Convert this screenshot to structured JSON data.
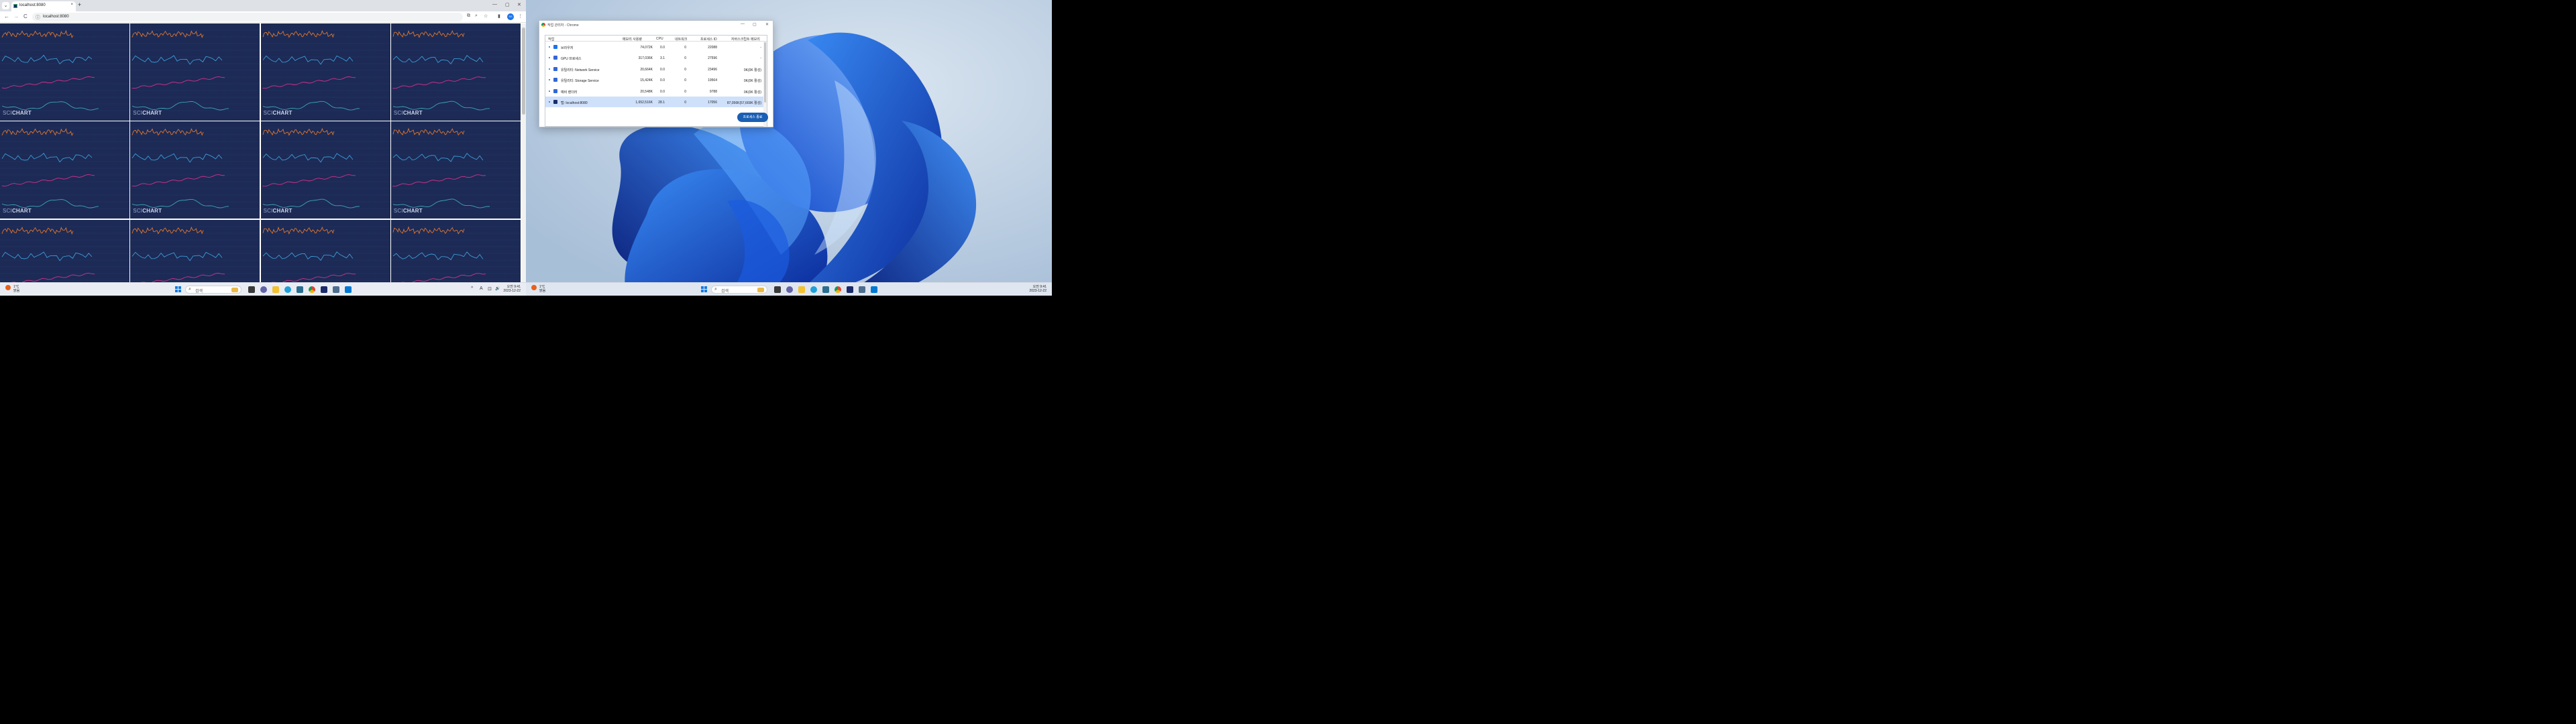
{
  "left_monitor": {
    "tab": {
      "title": "localhost:8080",
      "close": "×",
      "new_tab": "+",
      "menu": "⌄"
    },
    "window_controls": [
      "—",
      "▢",
      "✕"
    ],
    "toolbar": {
      "back": "←",
      "forward": "→",
      "reload": "C",
      "url": "localhost:8080",
      "site_icon": "ⓘ",
      "profile_initials": "SS"
    },
    "chart_grid": {
      "rows_visible": 3,
      "columns": 4,
      "logo_prefix": "SCI",
      "logo_suffix": "CHART",
      "series_colors": [
        "#e0762d",
        "#3d9bd6",
        "#d1328a",
        "#3fa5b8"
      ]
    }
  },
  "taskbar_left": {
    "weather_temp": "1°C",
    "weather_desc": "맑음",
    "search_placeholder": "검색",
    "clock_time": "오전 9:41",
    "clock_date": "2023-12-22",
    "tray": [
      "^",
      "A",
      "⊡",
      "🔊"
    ]
  },
  "task_manager": {
    "title": "작업 관리자 - Chrome",
    "window_controls": [
      "—",
      "▢",
      "✕"
    ],
    "columns": [
      "작업",
      "메모리 사용량",
      "CPU",
      "네트워크",
      "프로세스 ID",
      "자바스크립트 메모리"
    ],
    "rows": [
      {
        "name": "브라우저",
        "memory": "74,072K",
        "cpu": "0.0",
        "network": "0",
        "pid": "22088",
        "js_memory": "-",
        "icon_color": "#1a73e8",
        "selected": false
      },
      {
        "name": "GPU 프로세스",
        "memory": "317,036K",
        "cpu": "3.1",
        "network": "0",
        "pid": "27596",
        "js_memory": "-",
        "icon_color": "#3367d6",
        "selected": false
      },
      {
        "name": "유틸리티: Network Service",
        "memory": "20,664K",
        "cpu": "0.0",
        "network": "0",
        "pid": "23496",
        "js_memory": "0K(0K 활성)",
        "icon_color": "#3367d6",
        "selected": false
      },
      {
        "name": "유틸리티: Storage Service",
        "memory": "15,424K",
        "cpu": "0.0",
        "network": "0",
        "pid": "19564",
        "js_memory": "0K(0K 활성)",
        "icon_color": "#3367d6",
        "selected": false
      },
      {
        "name": "예비 렌더러",
        "memory": "20,548K",
        "cpu": "0.0",
        "network": "0",
        "pid": "9788",
        "js_memory": "0K(0K 활성)",
        "icon_color": "#3367d6",
        "selected": false
      },
      {
        "name": "탭: localhost:8080",
        "memory": "1,652,516K",
        "cpu": "28.1",
        "network": "0",
        "pid": "17056",
        "js_memory": "87,056K(57,669K 활성)",
        "icon_color": "#1a2a6c",
        "selected": true
      }
    ],
    "end_process_button": "프로세스 종료"
  },
  "taskbar_right": {
    "weather_temp": "1°C",
    "weather_desc": "맑음",
    "search_placeholder": "검색",
    "clock_time": "오전 9:41",
    "clock_date": "2023-12-22"
  }
}
